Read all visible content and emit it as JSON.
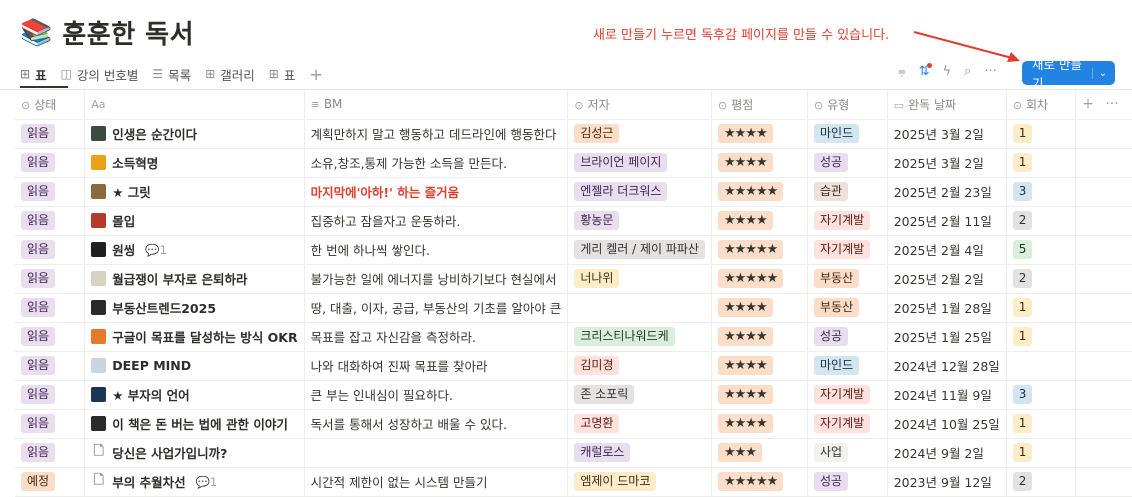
{
  "page": {
    "icon": "books-icon",
    "title": "훈훈한 독서"
  },
  "annotation": {
    "text": "새로 만들기 누르면 독후감 페이지를 만들 수 있습니다."
  },
  "tabs": [
    {
      "icon": "table-icon",
      "glyph": "⊞",
      "label": "표",
      "active": true
    },
    {
      "icon": "board-icon",
      "glyph": "◫",
      "label": "강의 번호별",
      "active": false
    },
    {
      "icon": "list-icon",
      "glyph": "☰",
      "label": "목록",
      "active": false
    },
    {
      "icon": "gallery-icon",
      "glyph": "⊞",
      "label": "갤러리",
      "active": false
    },
    {
      "icon": "table-icon",
      "glyph": "⊞",
      "label": "표",
      "active": false
    }
  ],
  "toolbar": {
    "new_label": "새로 만들기"
  },
  "columns": [
    {
      "key": "status",
      "icon": "⊙",
      "label": "상태"
    },
    {
      "key": "name",
      "icon": "Aa",
      "label": ""
    },
    {
      "key": "bm",
      "icon": "≡",
      "label": "BM"
    },
    {
      "key": "author",
      "icon": "⊙",
      "label": "저자"
    },
    {
      "key": "rating",
      "icon": "⊙",
      "label": "평점"
    },
    {
      "key": "type",
      "icon": "⊙",
      "label": "유형"
    },
    {
      "key": "date",
      "icon": "▭",
      "label": "완독 날짜"
    },
    {
      "key": "count",
      "icon": "⊙",
      "label": "회차"
    }
  ],
  "colors": {
    "accent": "#2383e2",
    "annotation": "#e03e2d"
  },
  "rows": [
    {
      "status": "읽음",
      "status_color": "purple",
      "cover": "#3a4a3c",
      "name": "인생은 순간이다",
      "comments": "",
      "bm": "계획만하지 말고 행동하고 데드라인에 행동한다",
      "bm_red": false,
      "author": "김성근",
      "author_color": "orange",
      "rating": "★★★★",
      "type": "마인드",
      "type_color": "blue",
      "date": "2025년 3월 2일",
      "count": "1",
      "count_color": "yellow"
    },
    {
      "status": "읽음",
      "status_color": "purple",
      "cover": "#e8a317",
      "name": "소득혁명",
      "comments": "",
      "bm": "소유,창조,통제 가능한 소득을 만든다.",
      "bm_red": false,
      "author": "브라이언 페이지",
      "author_color": "purple",
      "rating": "★★★★",
      "type": "성공",
      "type_color": "purple",
      "date": "2025년 3월 2일",
      "count": "1",
      "count_color": "yellow"
    },
    {
      "status": "읽음",
      "status_color": "purple",
      "cover": "#8b6a3e",
      "name": "★ 그릿",
      "comments": "",
      "bm": "마지막에'아하!' 하는 즐거움",
      "bm_red": true,
      "author": "엔젤라 더크워스",
      "author_color": "purple",
      "rating": "★★★★★",
      "type": "습관",
      "type_color": "brown",
      "date": "2025년 2월 23일",
      "count": "3",
      "count_color": "blue"
    },
    {
      "status": "읽음",
      "status_color": "purple",
      "cover": "#b33a2e",
      "name": "몰입",
      "comments": "",
      "bm": "집중하고 잠을자고 운동하라.",
      "bm_red": false,
      "author": "황농문",
      "author_color": "purple",
      "rating": "★★★★",
      "type": "자기계발",
      "type_color": "red",
      "date": "2025년 2월 11일",
      "count": "2",
      "count_color": "gray"
    },
    {
      "status": "읽음",
      "status_color": "purple",
      "cover": "#1f1f1f",
      "name": "원씽",
      "comments": "1",
      "bm": "한 번에 하나씩 쌓인다.",
      "bm_red": false,
      "author": "게리 켈러 / 제이 파파산",
      "author_color": "gray",
      "rating": "★★★★★",
      "type": "자기계발",
      "type_color": "red",
      "date": "2025년 2월 4일",
      "count": "5",
      "count_color": "green"
    },
    {
      "status": "읽음",
      "status_color": "purple",
      "cover": "#d9d2c0",
      "name": "월급쟁이 부자로 은퇴하라",
      "comments": "",
      "bm": "불가능한 일에 에너지를 낭비하기보다 현실에서",
      "bm_red": false,
      "author": "너나위",
      "author_color": "yellow",
      "rating": "★★★★★",
      "type": "부동산",
      "type_color": "orange",
      "date": "2025년 2월 2일",
      "count": "2",
      "count_color": "gray"
    },
    {
      "status": "읽음",
      "status_color": "purple",
      "cover": "#2a2a2a",
      "name": "부동산트렌드2025",
      "comments": "",
      "bm": "땅, 대출, 이자, 공급, 부동산의 기초를 알아야 큰",
      "bm_red": false,
      "author": "",
      "author_color": "",
      "rating": "★★★★",
      "type": "부동산",
      "type_color": "orange",
      "date": "2025년 1월 28일",
      "count": "1",
      "count_color": "yellow"
    },
    {
      "status": "읽음",
      "status_color": "purple",
      "cover": "#e7792b",
      "name": "구글이 목표를 달성하는 방식 OKR",
      "comments": "",
      "bm": "목표를 잡고 자신감을 측정하라.",
      "bm_red": false,
      "author": "크리스티나워드케",
      "author_color": "green",
      "rating": "★★★★",
      "type": "성공",
      "type_color": "purple",
      "date": "2025년 1월 25일",
      "count": "1",
      "count_color": "yellow"
    },
    {
      "status": "읽음",
      "status_color": "purple",
      "cover": "#c9d6de",
      "name": "DEEP MIND",
      "comments": "",
      "bm": "나와 대화하여 진짜 목표를 찾아라",
      "bm_red": false,
      "author": "김미경",
      "author_color": "red",
      "rating": "★★★★",
      "type": "마인드",
      "type_color": "blue",
      "date": "2024년 12월 28일",
      "count": "",
      "count_color": ""
    },
    {
      "status": "읽음",
      "status_color": "purple",
      "cover": "#1d3557",
      "name": "★ 부자의 언어",
      "comments": "",
      "bm": "큰 부는 인내심이 필요하다.",
      "bm_red": false,
      "author": "존 소포릭",
      "author_color": "gray",
      "rating": "★★★★",
      "type": "자기계발",
      "type_color": "red",
      "date": "2024년 11월 9일",
      "count": "3",
      "count_color": "blue"
    },
    {
      "status": "읽음",
      "status_color": "purple",
      "cover": "#2b2b2b",
      "name": "이 책은 돈 버는 법에 관한 이야기",
      "comments": "",
      "bm": "독서를 통해서 성장하고 배울 수 있다.",
      "bm_red": false,
      "author": "고명환",
      "author_color": "red",
      "rating": "★★★★",
      "type": "자기계발",
      "type_color": "red",
      "date": "2024년 10월 25일",
      "count": "1",
      "count_color": "yellow"
    },
    {
      "status": "읽음",
      "status_color": "purple",
      "cover": "",
      "name": "당신은 사업가입니까?",
      "comments": "",
      "bm": "",
      "bm_red": false,
      "author": "캐럴로스",
      "author_color": "purple",
      "rating": "★★★",
      "type": "사업",
      "type_color": "default",
      "date": "2024년 9월 2일",
      "count": "1",
      "count_color": "yellow"
    },
    {
      "status": "예정",
      "status_color": "orange",
      "cover": "",
      "name": "부의 추월차선",
      "comments": "1",
      "bm": "시간적 제한이 없는 시스템 만들기",
      "bm_red": false,
      "author": "엠제이 드마코",
      "author_color": "yellow",
      "rating": "★★★★★",
      "type": "성공",
      "type_color": "purple",
      "date": "2023년 9월 12일",
      "count": "2",
      "count_color": "gray"
    }
  ]
}
